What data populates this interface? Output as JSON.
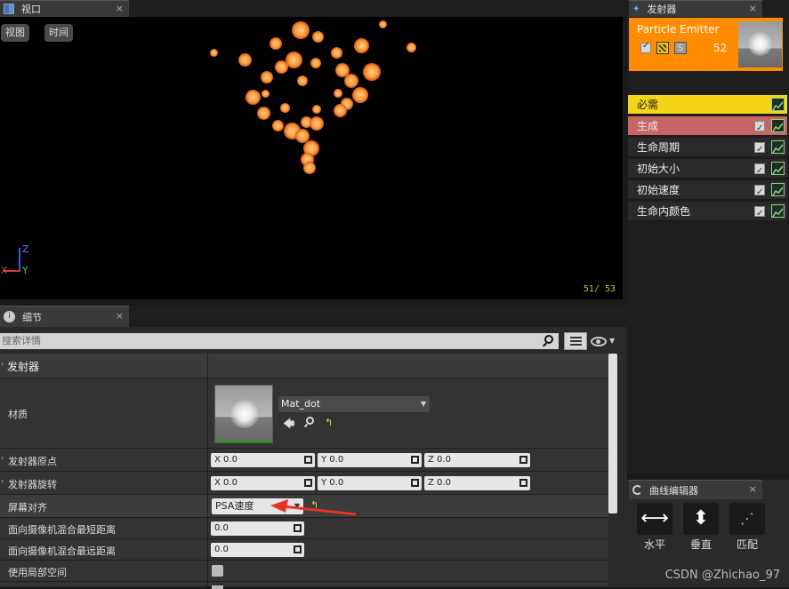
{
  "viewport": {
    "tab_label": "视口",
    "close_symbol": "×",
    "btn_view": "视图",
    "btn_time": "时间",
    "axis_z": "Z",
    "axis_x": "X",
    "axis_y": "Y",
    "particle_count": "51/ 53"
  },
  "details": {
    "tab_label": "细节",
    "close_symbol": "×",
    "search_placeholder": "搜索详情",
    "section_title": "发射器",
    "material_label": "材质",
    "material_value": "Mat_dot",
    "origin_label": "发射器原点",
    "rotation_label": "发射器旋转",
    "screen_align_label": "屏幕对齐",
    "screen_align_value": "PSA速度",
    "min_dist_label": "面向摄像机混合最短距离",
    "min_dist_value": "0.0",
    "max_dist_label": "面向摄像机混合最远距离",
    "max_dist_value": "0.0",
    "local_space_label": "使用局部空间",
    "origin": {
      "x": "X  0.0",
      "y": "Y  0.0",
      "z": "Z  0.0"
    },
    "rotation": {
      "x": "X  0.0",
      "y": "Y  0.0",
      "z": "Z  0.0"
    }
  },
  "emitters": {
    "tab_label": "发射器",
    "close_symbol": "×",
    "emitter_name": "Particle Emitter",
    "emitter_count": "52",
    "modules": [
      "必需",
      "生成",
      "生命周期",
      "初始大小",
      "初始速度",
      "生命内颜色"
    ]
  },
  "curve_editor": {
    "tab_label": "曲线编辑器",
    "close_symbol": "×",
    "buttons": [
      "水平",
      "垂直",
      "匹配"
    ]
  },
  "watermark": "CSDN @Zhichao_97",
  "colors": {
    "required_module_bg": "#f5d316",
    "spawn_module_bg": "#c86464",
    "emitter_card_bg": "#ff8c00",
    "arrow": "#e6322a"
  }
}
